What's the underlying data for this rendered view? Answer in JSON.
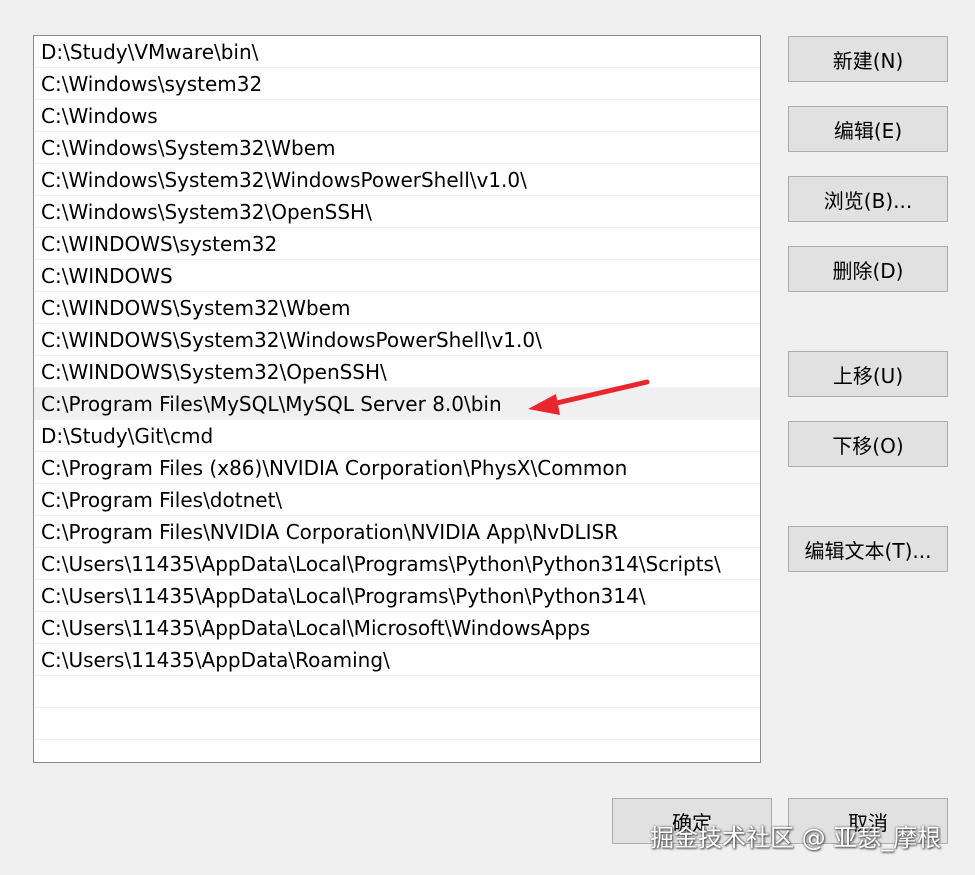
{
  "path_list": {
    "items": [
      "D:\\Study\\VMware\\bin\\",
      "C:\\Windows\\system32",
      "C:\\Windows",
      "C:\\Windows\\System32\\Wbem",
      "C:\\Windows\\System32\\WindowsPowerShell\\v1.0\\",
      "C:\\Windows\\System32\\OpenSSH\\",
      "C:\\WINDOWS\\system32",
      "C:\\WINDOWS",
      "C:\\WINDOWS\\System32\\Wbem",
      "C:\\WINDOWS\\System32\\WindowsPowerShell\\v1.0\\",
      "C:\\WINDOWS\\System32\\OpenSSH\\",
      "C:\\Program Files\\MySQL\\MySQL Server 8.0\\bin",
      "D:\\Study\\Git\\cmd",
      "C:\\Program Files (x86)\\NVIDIA Corporation\\PhysX\\Common",
      "C:\\Program Files\\dotnet\\",
      "C:\\Program Files\\NVIDIA Corporation\\NVIDIA App\\NvDLISR",
      "C:\\Users\\11435\\AppData\\Local\\Programs\\Python\\Python314\\Scripts\\",
      "C:\\Users\\11435\\AppData\\Local\\Programs\\Python\\Python314\\",
      "C:\\Users\\11435\\AppData\\Local\\Microsoft\\WindowsApps",
      "C:\\Users\\11435\\AppData\\Roaming\\"
    ],
    "selected_item": "C:\\Program Files\\MySQL\\MySQL Server 8.0\\bin"
  },
  "buttons": {
    "new": "新建(N)",
    "edit": "编辑(E)",
    "browse": "浏览(B)...",
    "delete": "删除(D)",
    "move_up": "上移(U)",
    "move_down": "下移(O)",
    "edit_text": "编辑文本(T)..."
  },
  "dialog_buttons": {
    "ok": "确定",
    "cancel": "取消"
  },
  "annotation": {
    "arrow_color": "#e8262d",
    "arrow_icon": "red-arrow-icon"
  },
  "watermark": "掘金技术社区 @ 亚瑟_摩根"
}
